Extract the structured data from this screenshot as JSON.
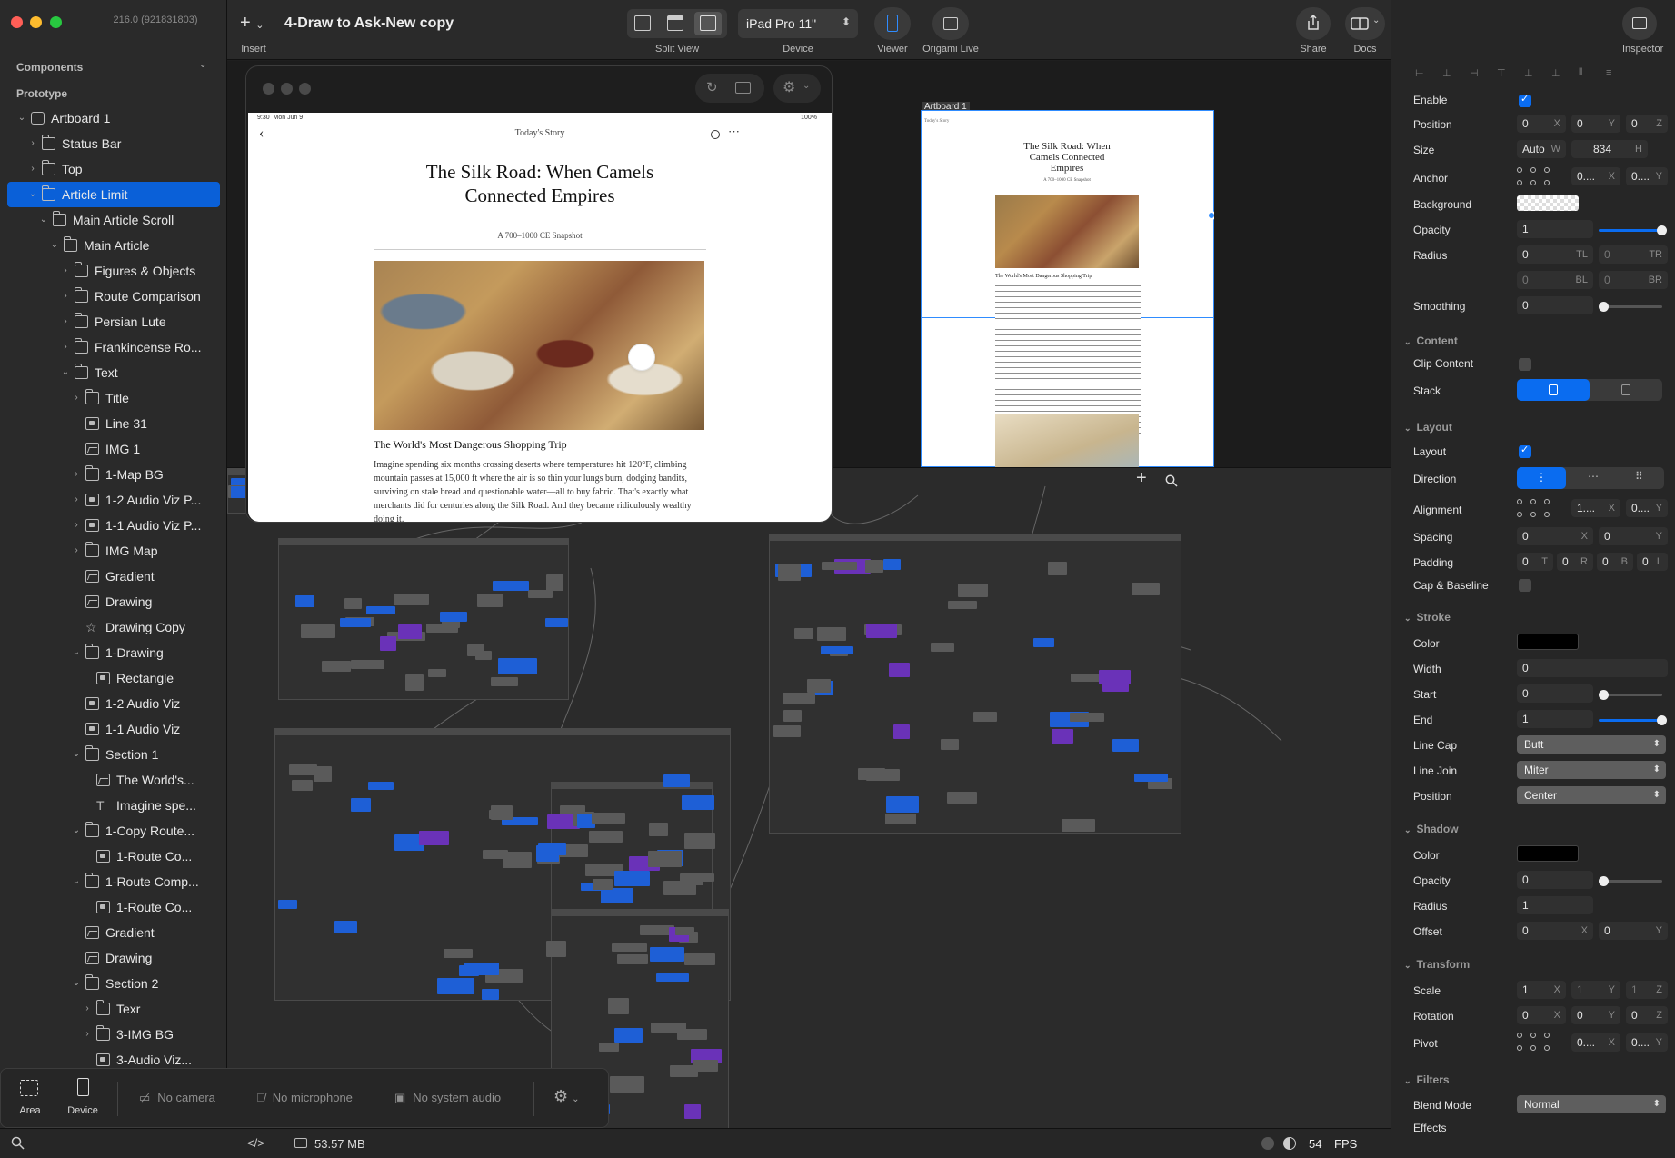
{
  "window": {
    "version": "216.0 (921831803)",
    "title": "4-Draw to Ask-New copy"
  },
  "sidebar": {
    "sections": {
      "components": "Components",
      "prototype": "Prototype"
    },
    "tree": [
      {
        "label": "Artboard 1",
        "indent": 0,
        "chev": "v",
        "icon": "artboard"
      },
      {
        "label": "Status Bar",
        "indent": 1,
        "chev": ">",
        "icon": "folder"
      },
      {
        "label": "Top",
        "indent": 1,
        "chev": ">",
        "icon": "folder"
      },
      {
        "label": "Article Limit",
        "indent": 1,
        "chev": "v",
        "icon": "folder",
        "selected": true
      },
      {
        "label": "Main Article Scroll",
        "indent": 2,
        "chev": "v",
        "icon": "folder"
      },
      {
        "label": "Main Article",
        "indent": 3,
        "chev": "v",
        "icon": "folder"
      },
      {
        "label": "Figures & Objects",
        "indent": 4,
        "chev": ">",
        "icon": "folder"
      },
      {
        "label": "Route Comparison",
        "indent": 4,
        "chev": ">",
        "icon": "folder"
      },
      {
        "label": "Persian Lute",
        "indent": 4,
        "chev": ">",
        "icon": "folder"
      },
      {
        "label": "Frankincense Ro...",
        "indent": 4,
        "chev": ">",
        "icon": "folder"
      },
      {
        "label": "Text",
        "indent": 4,
        "chev": "v",
        "icon": "folder"
      },
      {
        "label": "Title",
        "indent": 5,
        "chev": ">",
        "icon": "folder"
      },
      {
        "label": "Line 31",
        "indent": 5,
        "chev": "",
        "icon": "box"
      },
      {
        "label": "IMG 1",
        "indent": 5,
        "chev": "",
        "icon": "image"
      },
      {
        "label": "1-Map BG",
        "indent": 5,
        "chev": ">",
        "icon": "folder"
      },
      {
        "label": "1-2 Audio Viz P...",
        "indent": 5,
        "chev": ">",
        "icon": "box"
      },
      {
        "label": "1-1 Audio Viz P...",
        "indent": 5,
        "chev": ">",
        "icon": "box"
      },
      {
        "label": "IMG Map",
        "indent": 5,
        "chev": ">",
        "icon": "folder"
      },
      {
        "label": "Gradient",
        "indent": 5,
        "chev": "",
        "icon": "image"
      },
      {
        "label": "Drawing",
        "indent": 5,
        "chev": "",
        "icon": "image"
      },
      {
        "label": "Drawing Copy",
        "indent": 5,
        "chev": "",
        "icon": "star"
      },
      {
        "label": "1-Drawing",
        "indent": 5,
        "chev": "v",
        "icon": "folder"
      },
      {
        "label": "Rectangle",
        "indent": 6,
        "chev": "",
        "icon": "box"
      },
      {
        "label": "1-2 Audio Viz",
        "indent": 5,
        "chev": "",
        "icon": "box"
      },
      {
        "label": "1-1 Audio Viz",
        "indent": 5,
        "chev": "",
        "icon": "box"
      },
      {
        "label": "Section 1",
        "indent": 5,
        "chev": "v",
        "icon": "folder"
      },
      {
        "label": "The World's...",
        "indent": 6,
        "chev": "",
        "icon": "image"
      },
      {
        "label": "Imagine spe...",
        "indent": 6,
        "chev": "",
        "icon": "text"
      },
      {
        "label": "1-Copy Route...",
        "indent": 5,
        "chev": "v",
        "icon": "folder"
      },
      {
        "label": "1-Route Co...",
        "indent": 6,
        "chev": "",
        "icon": "box"
      },
      {
        "label": "1-Route Comp...",
        "indent": 5,
        "chev": "v",
        "icon": "folder"
      },
      {
        "label": "1-Route Co...",
        "indent": 6,
        "chev": "",
        "icon": "box"
      },
      {
        "label": "Gradient",
        "indent": 5,
        "chev": "",
        "icon": "image"
      },
      {
        "label": "Drawing",
        "indent": 5,
        "chev": "",
        "icon": "image"
      },
      {
        "label": "Section 2",
        "indent": 5,
        "chev": "v",
        "icon": "folder"
      },
      {
        "label": "Texr",
        "indent": 6,
        "chev": ">",
        "icon": "folder"
      },
      {
        "label": "3-IMG BG",
        "indent": 6,
        "chev": ">",
        "icon": "folder"
      },
      {
        "label": "3-Audio Viz...",
        "indent": 6,
        "chev": "",
        "icon": "box"
      }
    ]
  },
  "toolbar": {
    "insert": "Insert",
    "split_view": "Split View",
    "device_value": "iPad Pro 11\"",
    "device": "Device",
    "viewer": "Viewer",
    "origami_live": "Origami Live",
    "share": "Share",
    "docs": "Docs",
    "inspector": "Inspector"
  },
  "recorder": {
    "area": "Area",
    "device": "Device",
    "no_camera": "No camera",
    "no_microphone": "No microphone",
    "no_system_audio": "No system audio"
  },
  "status": {
    "memory": "53.57 MB",
    "fps_value": "54",
    "fps_label": "FPS"
  },
  "artboard": {
    "label": "Artboard 1"
  },
  "article": {
    "status_time": "9:30",
    "status_date": "Mon Jun 9",
    "battery": "100%",
    "header": "Today's Story",
    "title": "The Silk Road: When Camels Connected Empires",
    "subtitle": "A 700–1000 CE Snapshot",
    "section_heading": "The World's Most Dangerous Shopping Trip",
    "body": "Imagine spending six months crossing deserts where temperatures hit 120°F, climbing mountain passes at 15,000 ft where the air is so thin your lungs burn, dodging bandits, surviving on stale bread and questionable water—all to buy fabric. That's exactly what merchants did for centuries along the Silk Road. And they became ridiculously wealthy doing it."
  },
  "inspector": {
    "enable": "Enable",
    "position": "Position",
    "size": "Size",
    "anchor": "Anchor",
    "background": "Background",
    "opacity": "Opacity",
    "radius": "Radius",
    "smoothing": "Smoothing",
    "content_h": "Content",
    "clip_content": "Clip Content",
    "stack": "Stack",
    "layout_h": "Layout",
    "layout": "Layout",
    "direction": "Direction",
    "alignment": "Alignment",
    "spacing": "Spacing",
    "padding": "Padding",
    "cap_baseline": "Cap & Baseline",
    "stroke_h": "Stroke",
    "color": "Color",
    "width": "Width",
    "start": "Start",
    "end": "End",
    "line_cap": "Line Cap",
    "line_join": "Line Join",
    "position_l": "Position",
    "shadow_h": "Shadow",
    "s_color": "Color",
    "s_opacity": "Opacity",
    "s_radius": "Radius",
    "offset": "Offset",
    "transform_h": "Transform",
    "scale": "Scale",
    "rotation": "Rotation",
    "pivot": "Pivot",
    "filters_h": "Filters",
    "blend_mode": "Blend Mode",
    "effects": "Effects",
    "values": {
      "pos_x": "0",
      "pos_y": "0",
      "pos_z": "0",
      "size_w": "Auto",
      "size_h": "834",
      "anchor_x": "0....",
      "anchor_y": "0....",
      "opacity": "1",
      "radius_tl": "0",
      "radius_tr": "0",
      "radius_bl": "0",
      "radius_br": "0",
      "smoothing": "0",
      "align_x": "1....",
      "align_y": "0....",
      "spacing_x": "0",
      "spacing_y": "0",
      "pad_t": "0",
      "pad_r": "0",
      "pad_b": "0",
      "pad_l": "0",
      "stroke_width": "0",
      "stroke_start": "0",
      "stroke_end": "1",
      "line_cap": "Butt",
      "line_join": "Miter",
      "stroke_position": "Center",
      "shadow_opacity": "0",
      "shadow_radius": "1",
      "offset_x": "0",
      "offset_y": "0",
      "scale_x": "1",
      "scale_y": "1",
      "scale_z": "1",
      "rot_x": "0",
      "rot_y": "0",
      "rot_z": "0",
      "pivot_x": "0....",
      "pivot_y": "0....",
      "blend_mode": "Normal"
    },
    "suffix": {
      "x": "X",
      "y": "Y",
      "z": "Z",
      "w": "W",
      "h": "H",
      "tl": "TL",
      "tr": "TR",
      "bl": "BL",
      "br": "BR",
      "t": "T",
      "r": "R",
      "b": "B",
      "l": "L"
    }
  },
  "colors": {
    "accent": "#0a60d8",
    "node_blue": "#1e5fd6",
    "node_purple": "#6a32b8"
  }
}
